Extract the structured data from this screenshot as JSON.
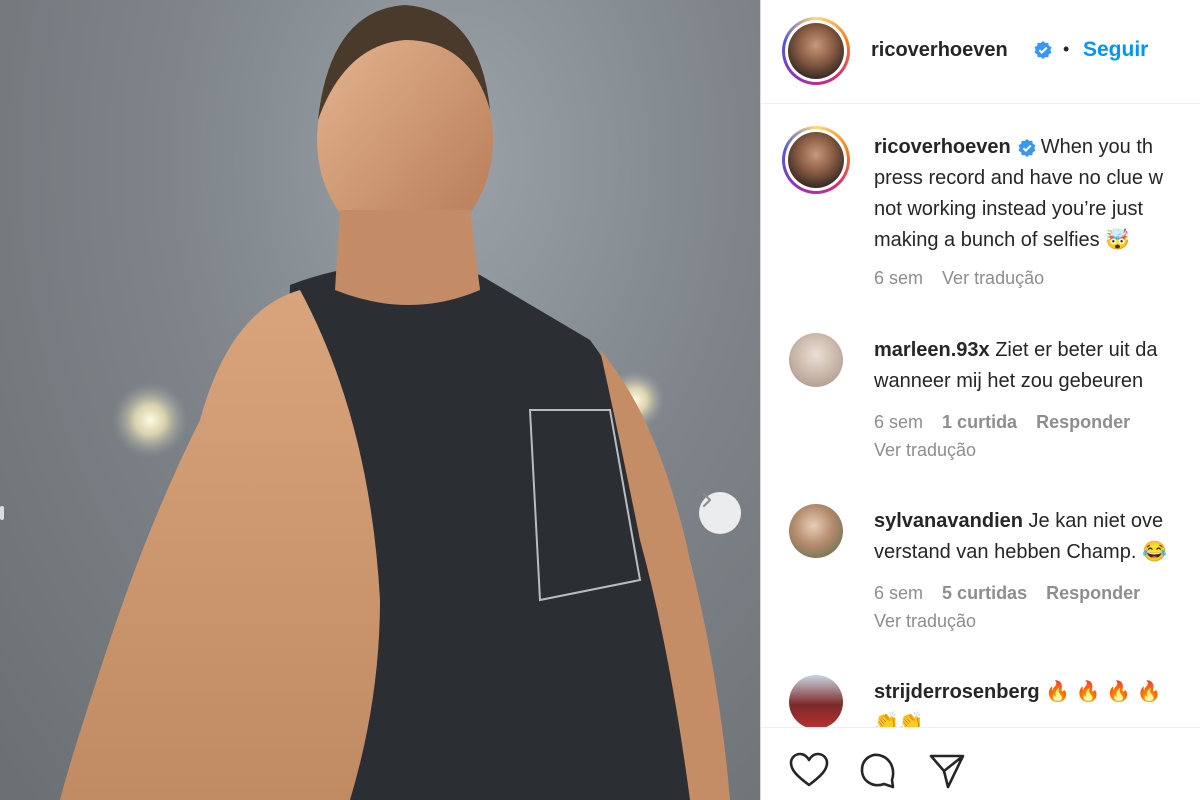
{
  "post": {
    "carousel": {
      "next_icon": "chevron-right-icon"
    }
  },
  "header": {
    "username": "ricoverhoeven",
    "separator": "•",
    "follow_label": "Seguir"
  },
  "caption": {
    "username": "ricoverhoeven",
    "lines": [
      "When you th",
      "press record and have no clue w",
      "not working instead you’re just",
      "making a bunch of selfies 🤯"
    ],
    "time": "6 sem",
    "translate": "Ver tradução"
  },
  "comments": [
    {
      "username": "marleen.93x",
      "lines": [
        "Ziet er beter uit da",
        "wanneer mij het zou gebeuren"
      ],
      "time": "6 sem",
      "likes": "1 curtida",
      "reply": "Responder",
      "translate": "Ver tradução"
    },
    {
      "username": "sylvanavandien",
      "lines": [
        "Je kan niet ove",
        "verstand van hebben Champ. 😂"
      ],
      "time": "6 sem",
      "likes": "5 curtidas",
      "reply": "Responder",
      "translate": "Ver tradução"
    },
    {
      "username": "strijderrosenberg",
      "lines": [
        "🔥 🔥 🔥 🔥",
        "👏👏"
      ]
    }
  ],
  "actions": {
    "like_icon": "heart-icon",
    "comment_icon": "comment-icon",
    "share_icon": "share-icon"
  },
  "colors": {
    "link": "#0095f6",
    "verified": "#3897f0",
    "muted": "#8e8e8e",
    "text": "#262626"
  }
}
